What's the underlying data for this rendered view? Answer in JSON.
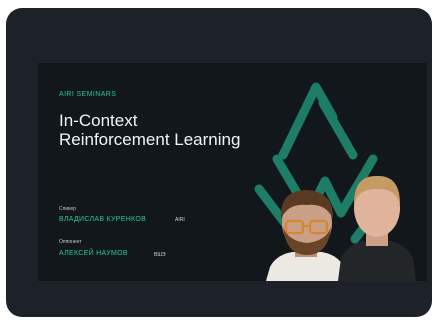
{
  "banner": {
    "tag": "AIRI SEMINARS",
    "title_line1": "In-Context",
    "title_line2": "Reinforcement Learning",
    "speaker_role": "Спикер",
    "speaker_name": "ВЛАДИСЛАВ КУРЕНКОВ",
    "speaker_org": "AIRI",
    "opponent_role": "Оппонент",
    "opponent_name": "АЛЕКСЕЙ НАУМОВ",
    "opponent_org": "ВШЭ"
  },
  "colors": {
    "card_bg": "#1c2228",
    "banner_bg": "#12171c",
    "accent": "#2cc79b",
    "title": "#f2f4f5"
  },
  "icons": [
    "airi-logo-decoration-icon"
  ]
}
